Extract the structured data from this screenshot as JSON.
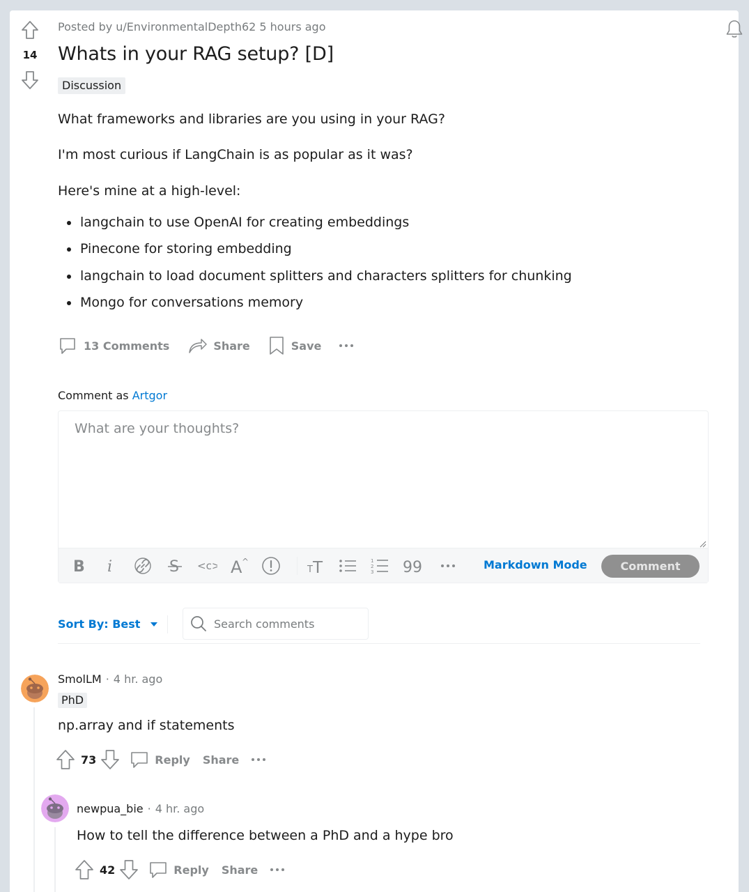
{
  "post": {
    "score": "14",
    "meta": "Posted by u/EnvironmentalDepth62 5 hours ago",
    "title": "Whats in your RAG setup? [D]",
    "flair": "Discussion",
    "paragraphs": [
      "What frameworks and libraries are you using in your RAG?",
      "I'm most curious if LangChain is as popular as it was?",
      "Here's mine at a high-level:"
    ],
    "bullets": [
      "langchain to use OpenAI for creating embeddings",
      "Pinecone for storing embedding",
      "langchain to load document splitters and characters splitters for chunking",
      "Mongo for conversations memory"
    ],
    "actions": {
      "comments": "13 Comments",
      "share": "Share",
      "save": "Save"
    }
  },
  "composer": {
    "comment_as_label": "Comment as",
    "username": "Artgor",
    "placeholder": "What are your thoughts?",
    "markdown_mode": "Markdown Mode",
    "submit": "Comment",
    "toolbar_icons": [
      "bold-icon",
      "italic-icon",
      "link-icon",
      "strikethrough-icon",
      "inline-code-icon",
      "superscript-icon",
      "spoiler-icon",
      "heading-icon",
      "bulleted-list-icon",
      "numbered-list-icon",
      "quote-icon",
      "more-icon"
    ]
  },
  "sort": {
    "label": "Sort By: Best",
    "search_placeholder": "Search comments"
  },
  "comments": [
    {
      "author": "SmolLM",
      "time": "4 hr. ago",
      "flair": "PhD",
      "text": "np.array and if statements",
      "score": "73",
      "reply": "Reply",
      "share": "Share",
      "avatar_color": "#f6a35a"
    },
    {
      "author": "newpua_bie",
      "time": "4 hr. ago",
      "text": "How to tell the difference between a PhD and a hype bro",
      "score": "42",
      "reply": "Reply",
      "share": "Share",
      "avatar_color": "#e3a9ef"
    }
  ],
  "colors": {
    "accent": "#0079d3",
    "muted": "#878a8c",
    "page_bg": "#dae0e6"
  }
}
